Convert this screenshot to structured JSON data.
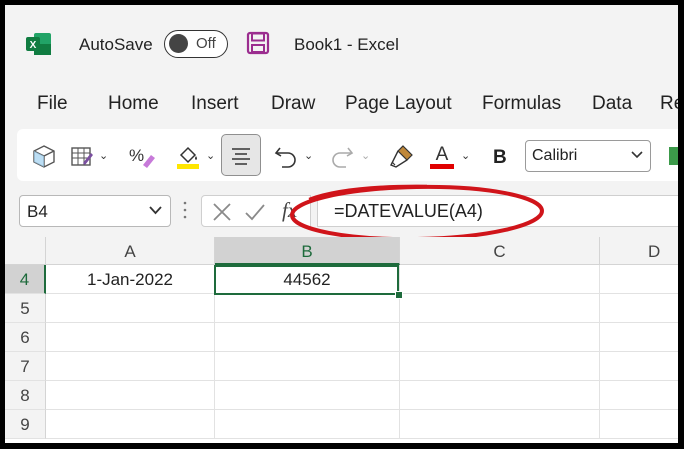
{
  "titlebar": {
    "autosave_label": "AutoSave",
    "autosave_state": "Off",
    "doc_title": "Book1  -  Excel"
  },
  "menu": [
    "File",
    "Home",
    "Insert",
    "Draw",
    "Page Layout",
    "Formulas",
    "Data",
    "Re"
  ],
  "ribbon": {
    "bold_label": "B",
    "font_name": "Calibri"
  },
  "formula_bar": {
    "name_box": "B4",
    "fx_label": "fx",
    "formula": "=DATEVALUE(A4)"
  },
  "grid": {
    "columns": [
      "A",
      "B",
      "C",
      "D"
    ],
    "rows": [
      "4",
      "5",
      "6",
      "7",
      "8",
      "9"
    ],
    "cells": {
      "A4": "1-Jan-2022",
      "B4": "44562"
    }
  },
  "colors": {
    "excel_green": "#1e6b3c",
    "annotation_red": "#d0141a",
    "fill_yellow": "#ffe600",
    "font_red": "#e00000"
  }
}
